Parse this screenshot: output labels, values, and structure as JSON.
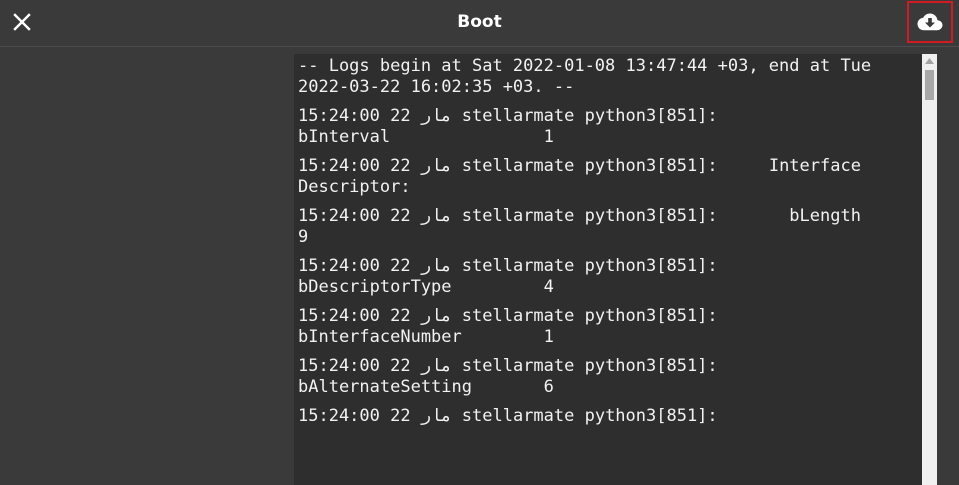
{
  "dialog": {
    "title": "Boot"
  },
  "icons": {
    "close": "close-icon",
    "download": "cloud-download-icon"
  },
  "colors": {
    "background": "#3a3a3a",
    "log_background": "#2e2e2e",
    "highlight_border": "#d11a22",
    "text": "#f2f2f2"
  },
  "log": {
    "header": "-- Logs begin at Sat 2022-01-08 13:47:44 +03, end at Tue 2022-03-22 16:02:35 +03. --",
    "entries": [
      "15:24:00 22 مار stellarmate python3[851]:            bInterval               1",
      "15:24:00 22 مار stellarmate python3[851]:     Interface Descriptor:",
      "15:24:00 22 مار stellarmate python3[851]:       bLength                 9",
      "15:24:00 22 مار stellarmate python3[851]:       bDescriptorType         4",
      "15:24:00 22 مار stellarmate python3[851]:       bInterfaceNumber        1",
      "15:24:00 22 مار stellarmate python3[851]:       bAlternateSetting       6",
      "15:24:00 22 مار stellarmate python3[851]:"
    ]
  }
}
